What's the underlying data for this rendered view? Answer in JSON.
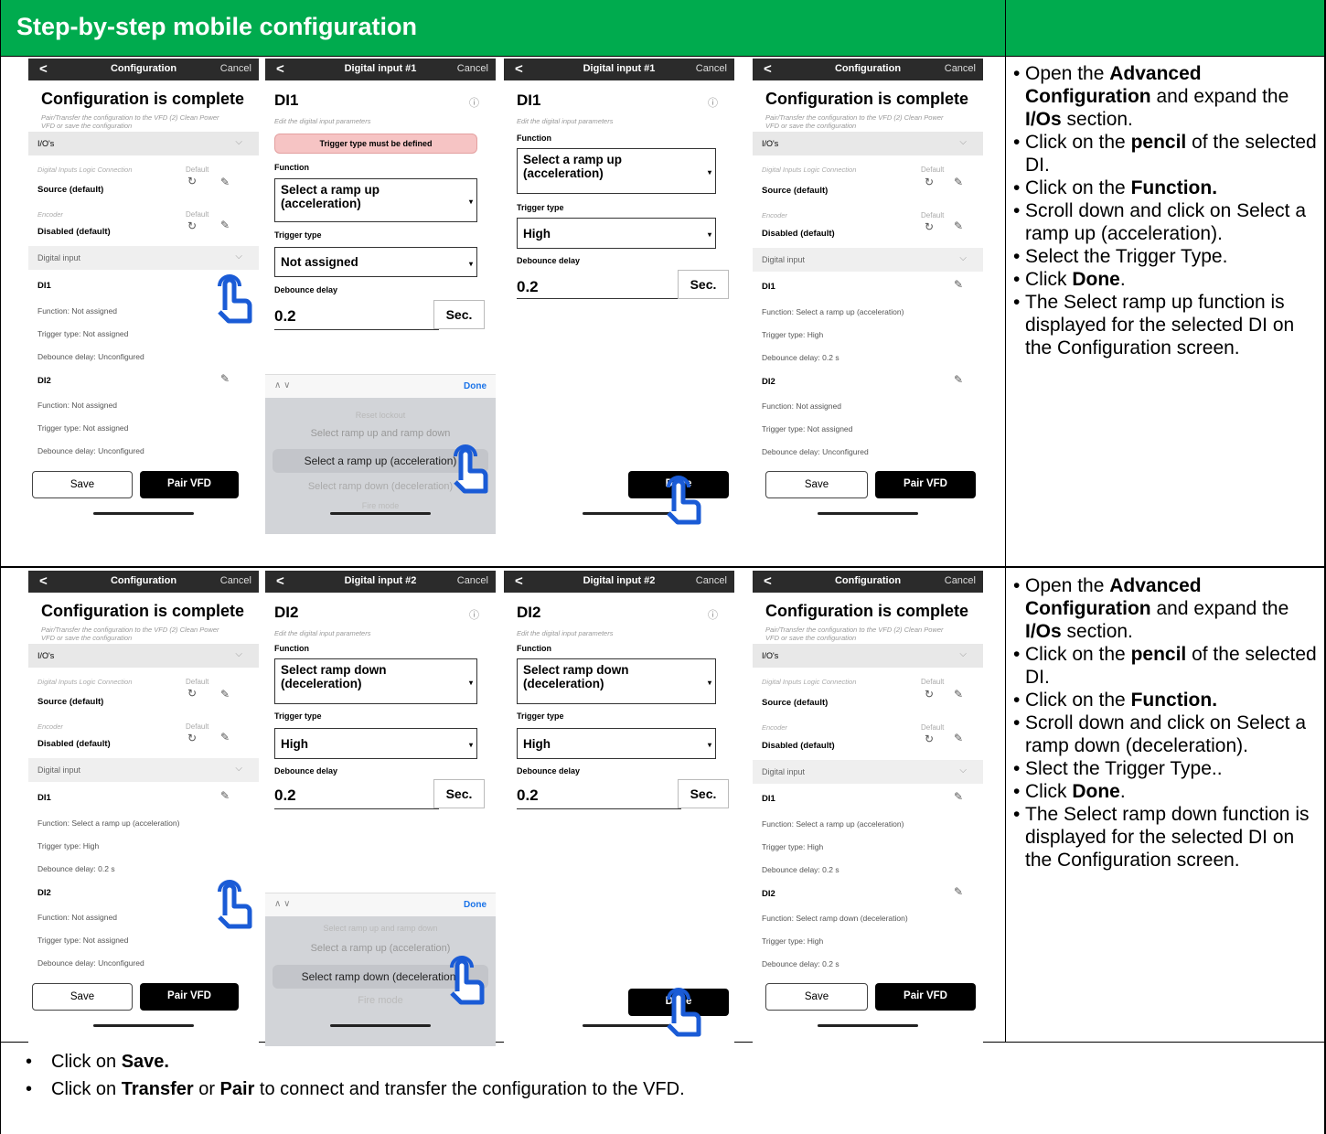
{
  "header": {
    "title": "Step-by-step mobile configuration"
  },
  "common": {
    "back": "<",
    "cancel": "Cancel",
    "config_title": "Configuration",
    "complete": "Configuration is complete",
    "complete_sub_1": "Pair/Transfer the configuration to the VFD (2) Clean Power",
    "complete_sub_2": "VFD or save the configuration",
    "ios": "I/O's",
    "dilc": "Digital Inputs Logic Connection",
    "default": "Default",
    "source": "Source (default)",
    "encoder": "Encoder",
    "disabled": "Disabled (default)",
    "digital_input": "Digital input",
    "di1": "DI1",
    "di2": "DI2",
    "save": "Save",
    "pair": "Pair VFD",
    "edit_sub": "Edit the digital input parameters",
    "function": "Function",
    "trigger": "Trigger type",
    "debounce": "Debounce delay",
    "sec": "Sec.",
    "deb_val": "0.2",
    "done": "Done",
    "done_btn": "Done",
    "ramp_up_1": "Select a ramp up",
    "ramp_up_2": "(acceleration)",
    "ramp_down_1": "Select ramp down",
    "ramp_down_2": "(deceleration)",
    "not_assigned_box": "Not assigned",
    "high": "High",
    "warn": "Trigger type must be defined",
    "fn_na": "Function: Not assigned",
    "tt_na": "Trigger type: Not assigned",
    "dd_un": "Debounce delay: Unconfigured",
    "fn_up": "Function: Select a ramp up (acceleration)",
    "fn_down": "Function: Select ramp down (deceleration)",
    "tt_high": "Trigger type: High",
    "dd_02": "Debounce delay: 0.2 s",
    "di1_title": "Digital input #1",
    "di2_title": "Digital input #2"
  },
  "picker1": [
    "Reset lockout",
    "Select ramp up and ramp down",
    "Select a ramp up (acceleration)",
    "Select ramp down (deceleration)",
    "Fire mode"
  ],
  "picker2": [
    "Select ramp up and ramp down",
    "Select a ramp up (acceleration)",
    "Select ramp down (deceleration)",
    "Fire mode"
  ],
  "row1": {
    "instructions": [
      {
        "a": "Open the ",
        "b": "Advanced Configuration",
        "c": " and expand the ",
        "d": "I/Os",
        "e": " section."
      },
      {
        "a": "Click on the ",
        "b": "pencil",
        "c": " of the selected DI."
      },
      {
        "a": "Click on the ",
        "b": "Function."
      },
      {
        "a": "Scroll down and click on Select a ramp up (acceleration)."
      },
      {
        "a": "Select the Trigger Type."
      },
      {
        "a": "Click ",
        "b": "Done",
        "c": "."
      },
      {
        "a": "The Select ramp up function is displayed for the selected DI on the Configuration screen."
      }
    ]
  },
  "row2": {
    "instructions": [
      {
        "a": "Open the ",
        "b": "Advanced Configuration",
        "c": " and expand the ",
        "d": "I/Os",
        "e": " section."
      },
      {
        "a": "Click on the ",
        "b": "pencil",
        "c": " of the selected DI."
      },
      {
        "a": "Click on the ",
        "b": "Function."
      },
      {
        "a": "Scroll down and click on Select a ramp down (deceleration)."
      },
      {
        "a": "Slect the Trigger Type.."
      },
      {
        "a": "Click ",
        "b": "Done",
        "c": "."
      },
      {
        "a": "The Select ramp down function is displayed for the selected DI on the Configuration screen."
      }
    ]
  },
  "footer": [
    {
      "a": "Click on ",
      "b": "Save."
    },
    {
      "a": "Click on ",
      "b": "Transfer",
      "c": " or ",
      "d": "Pair",
      "e": " to connect and transfer the configuration to the VFD."
    }
  ],
  "colors": {
    "header": "#00ab4e"
  },
  "icons": [
    "hand-pointer-icon",
    "pencil-icon",
    "reset-icon",
    "chevron-down-icon",
    "help-icon"
  ]
}
